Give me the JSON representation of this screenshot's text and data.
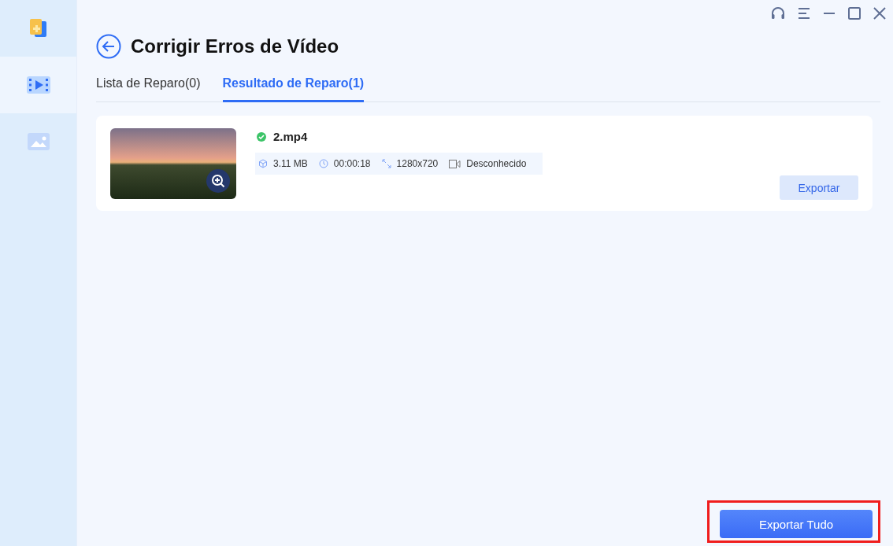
{
  "sidebar": {
    "items": [
      {
        "kind": "puzzle",
        "selected": false
      },
      {
        "kind": "video",
        "selected": true
      },
      {
        "kind": "image",
        "selected": false
      }
    ]
  },
  "window": {
    "title": "Corrigir Erros de Vídeo"
  },
  "tabs": [
    {
      "label": "Lista de Reparo(0)",
      "selected": false
    },
    {
      "label": "Resultado de Reparo(1)",
      "selected": true
    }
  ],
  "results": [
    {
      "file_name": "2.mp4",
      "size": "3.11 MB",
      "duration": "00:00:18",
      "resolution": "1280x720",
      "codec": "Desconhecido",
      "export_button": "Exportar"
    }
  ],
  "footer": {
    "export_all_button": "Exportar Tudo",
    "highlighted": true
  }
}
